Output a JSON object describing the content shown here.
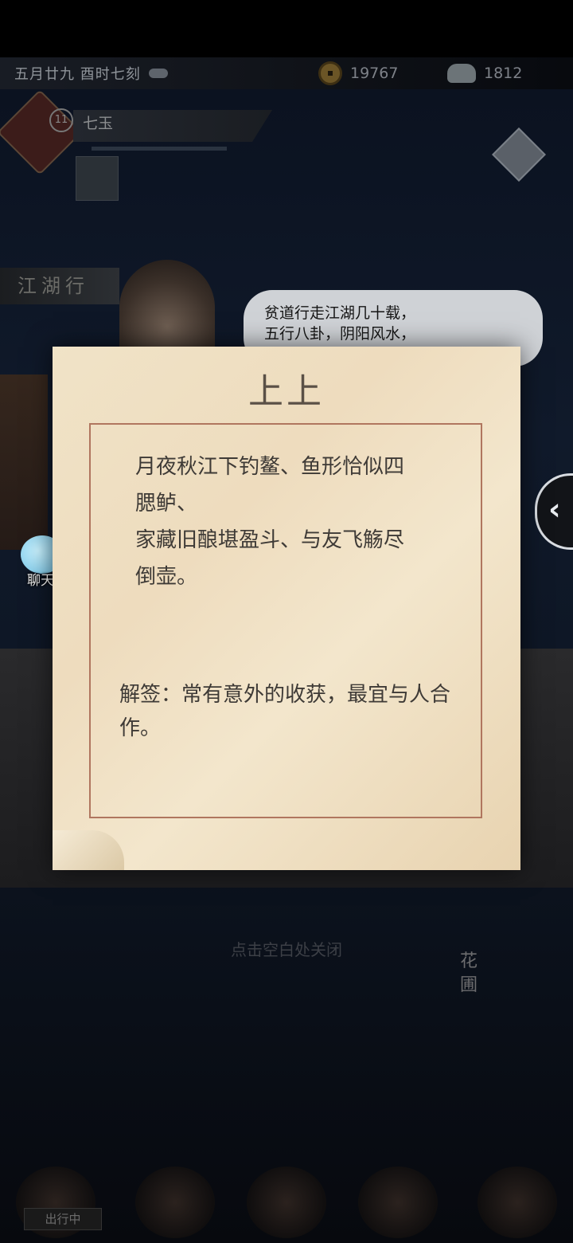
{
  "hud": {
    "date": "五月廿九 酉时七刻",
    "coins": "19767",
    "jade": "1812"
  },
  "player": {
    "level": "11",
    "name": "七玉"
  },
  "location_tag": "江湖行",
  "npc_speech": "贫道行走江湖几十载，\n五行八卦，阴阳风水，",
  "side_buttons": {
    "chat_label": "聊天"
  },
  "fortune": {
    "title": "上上",
    "poem": "月夜秋江下钓鳌、鱼形恰似四\n腮鲈、\n家藏旧酿堪盈斗、与友飞觞尽\n倒壶。",
    "explanation": "解签：常有意外的收获，最宜与人合作。"
  },
  "close_hint": "点击空白处关闭",
  "garden_label": "花圃",
  "bottom_nav": {
    "first_label": "出行中"
  },
  "colors": {
    "paper": "#f0e3c7",
    "frame_border": "#b0765f",
    "text": "#3e3a36"
  }
}
